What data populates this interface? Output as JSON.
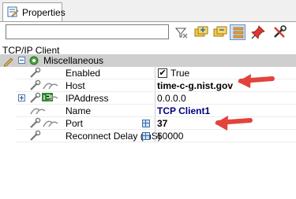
{
  "tab": {
    "label": "Properties"
  },
  "search": {
    "placeholder": "",
    "value": ""
  },
  "object_label": "TCP/IP Client",
  "category": {
    "label": "Miscellaneous"
  },
  "properties": [
    {
      "name": "Enabled",
      "value": "True"
    },
    {
      "name": "Host",
      "value": "time-c-g.nist.gov"
    },
    {
      "name": "IPAddress",
      "value": "0.0.0.0"
    },
    {
      "name": "Name",
      "value": "TCP Client1"
    },
    {
      "name": "Port",
      "value": "37"
    },
    {
      "name": "Reconnect Delay (mS)",
      "value": "60000"
    }
  ],
  "checkbox_mark": "✔",
  "colors": {
    "arrow": "#e2443c",
    "category_bg": "#cfcfcf",
    "value_navy": "#000080"
  }
}
